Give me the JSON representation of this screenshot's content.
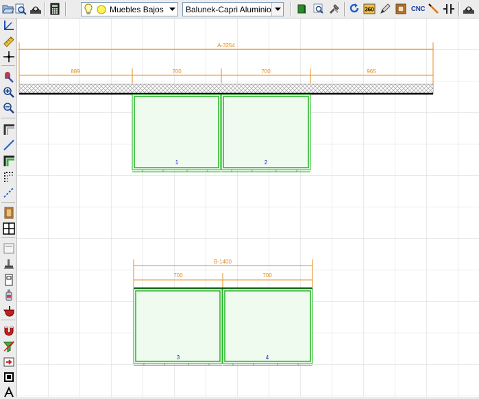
{
  "toolbar": {
    "category_select": {
      "value": "Muebles Bajos"
    },
    "material_select": {
      "value": "Balunek-Capri Aluminio"
    },
    "badge_360": "360",
    "cnc_label": "CNC"
  },
  "drawing": {
    "top_run": {
      "total_label": "A-3254",
      "segment_labels": [
        "889",
        "700",
        "700",
        "965"
      ]
    },
    "bottom_run": {
      "total_label": "B-1400",
      "segment_labels": [
        "700",
        "700"
      ]
    },
    "cabinet_numbers": [
      "1",
      "2",
      "3",
      "4"
    ]
  },
  "colors": {
    "dimension": "#e88a1a",
    "cabinet_stroke": "#22b522",
    "cabinet_fill": "#eefbee",
    "cabinet_number": "#1a1ad0",
    "grid": "#d4d4d4",
    "wall": "#000000"
  }
}
